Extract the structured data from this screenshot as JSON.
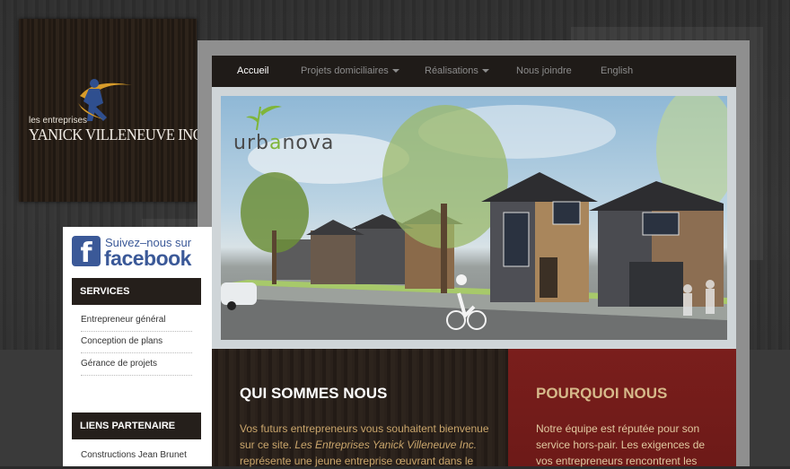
{
  "logo": {
    "small_text": "les entreprises",
    "big_text": "YANICK VILLENEUVE INC."
  },
  "nav": {
    "items": [
      {
        "label": "Accueil",
        "active": true,
        "dropdown": false
      },
      {
        "label": "Projets domiciliaires",
        "active": false,
        "dropdown": true
      },
      {
        "label": "Réalisations",
        "active": false,
        "dropdown": true
      },
      {
        "label": "Nous joindre",
        "active": false,
        "dropdown": false
      },
      {
        "label": "English",
        "active": false,
        "dropdown": false
      }
    ]
  },
  "hero": {
    "brand_prefix": "urb",
    "brand_o": "a",
    "brand_suffix": "nova"
  },
  "sidebar": {
    "facebook_line1": "Suivez–nous sur",
    "facebook_line2": "facebook",
    "facebook_logo": "f",
    "services_title": "SERVICES",
    "services": [
      "Entrepreneur général",
      "Conception de plans",
      "Gérance de projets"
    ],
    "partners_title": "LIENS PARTENAIRE",
    "partners": [
      "Constructions Jean Brunet"
    ]
  },
  "about": {
    "title": "QUI SOMMES NOUS",
    "line1": "Vos futurs entrepreneurs vous souhaitent bienvenue",
    "line2_a": "sur ce site. ",
    "line2_em": "Les Entreprises Yanick Villeneuve Inc.",
    "line3": "représente une jeune entreprise œuvrant dans le"
  },
  "why": {
    "title": "POURQUOI NOUS",
    "line1": "Notre équipe est réputée pour son",
    "line2": "service hors-pair. Les exigences de",
    "line3": "vos entrepreneurs rencontrent les"
  },
  "colors": {
    "nav_bg": "#1f1b18",
    "accent_red": "#7a1e1c",
    "title_gold": "#d6b98a",
    "facebook": "#3b5998"
  }
}
